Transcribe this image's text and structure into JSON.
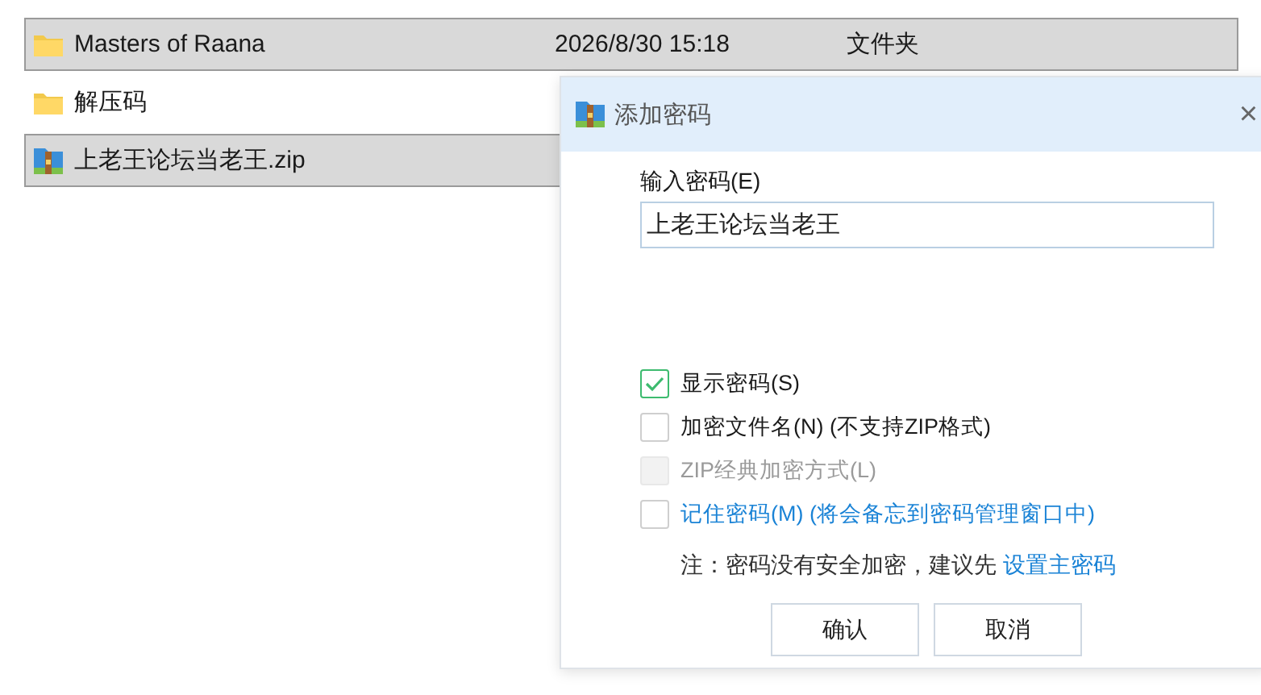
{
  "files": [
    {
      "name": "Masters of Raana",
      "kind": "folder",
      "date": "2026/8/30 15:18",
      "type": "文件夹",
      "selected": true
    },
    {
      "name": "解压码",
      "kind": "folder",
      "selected": false
    },
    {
      "name": "上老王论坛当老王.zip",
      "kind": "archive",
      "selected": true
    }
  ],
  "dialog": {
    "title": "添加密码",
    "close": "×",
    "password_label": "输入密码(E)",
    "password_value": "上老王论坛当老王",
    "options": [
      {
        "label": "显示密码(S)",
        "checked": true,
        "disabled": false,
        "link": false
      },
      {
        "label": "加密文件名(N) (不支持ZIP格式)",
        "checked": false,
        "disabled": false,
        "link": false
      },
      {
        "label": "ZIP经典加密方式(L)",
        "checked": false,
        "disabled": true,
        "link": false
      },
      {
        "label": "记住密码(M) (将会备忘到密码管理窗口中)",
        "checked": false,
        "disabled": false,
        "link": true
      }
    ],
    "note": "注：密码没有安全加密，建议先",
    "note_link": "设置主密码",
    "buttons": [
      "确认",
      "取消"
    ]
  }
}
